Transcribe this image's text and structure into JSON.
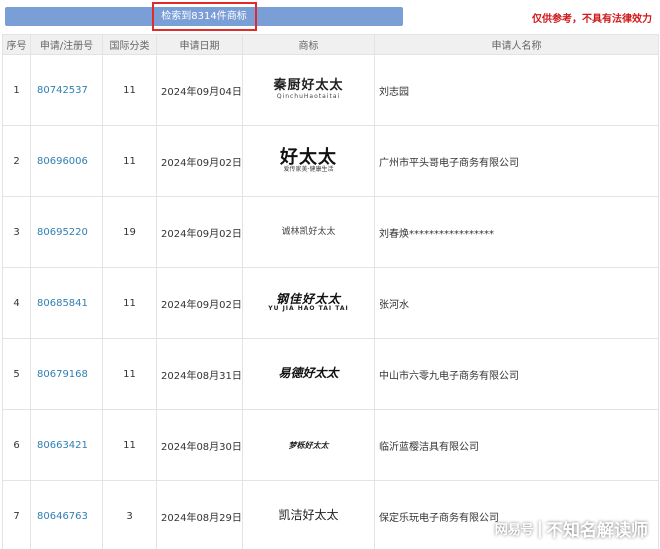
{
  "header": {
    "result_count": "检索到8314件商标",
    "disclaimer": "仅供参考，不具有法律效力"
  },
  "table": {
    "columns": [
      "序号",
      "申请/注册号",
      "国际分类",
      "申请日期",
      "商标",
      "申请人名称"
    ],
    "rows": [
      {
        "no": "1",
        "app_no": "80742537",
        "class": "11",
        "date": "2024年09月04日",
        "mark_text": "秦厨好太太",
        "mark_sub": "QinchuHaotaitai",
        "applicant": "刘志园"
      },
      {
        "no": "2",
        "app_no": "80696006",
        "class": "11",
        "date": "2024年09月02日",
        "mark_text": "好太太",
        "mark_sub": "爱传家美·健康生活",
        "applicant": "广州市平头哥电子商务有限公司"
      },
      {
        "no": "3",
        "app_no": "80695220",
        "class": "19",
        "date": "2024年09月02日",
        "mark_text": "诚林凯好太太",
        "mark_sub": "",
        "applicant": "刘春焕*****************"
      },
      {
        "no": "4",
        "app_no": "80685841",
        "class": "11",
        "date": "2024年09月02日",
        "mark_text": "钢佳好太太",
        "mark_sub": "YU JIA HAO TAI TAI",
        "applicant": "张河水"
      },
      {
        "no": "5",
        "app_no": "80679168",
        "class": "11",
        "date": "2024年08月31日",
        "mark_text": "易德好太太",
        "mark_sub": "",
        "applicant": "中山市六零九电子商务有限公司"
      },
      {
        "no": "6",
        "app_no": "80663421",
        "class": "11",
        "date": "2024年08月30日",
        "mark_text": "梦栎好太太",
        "mark_sub": "",
        "applicant": "临沂蓝樱洁具有限公司"
      },
      {
        "no": "7",
        "app_no": "80646763",
        "class": "3",
        "date": "2024年08月29日",
        "mark_text": "凯洁好太太",
        "mark_sub": "",
        "applicant": "保定乐玩电子商务有限公司"
      }
    ]
  },
  "watermark": {
    "logo": "网易号",
    "separator": "|",
    "author": "不知名解读师"
  },
  "colors": {
    "result_bar": "#7a9ed6",
    "highlight": "#e02b2b",
    "disclaimer": "#d0181a",
    "link": "#2f7fb3"
  }
}
